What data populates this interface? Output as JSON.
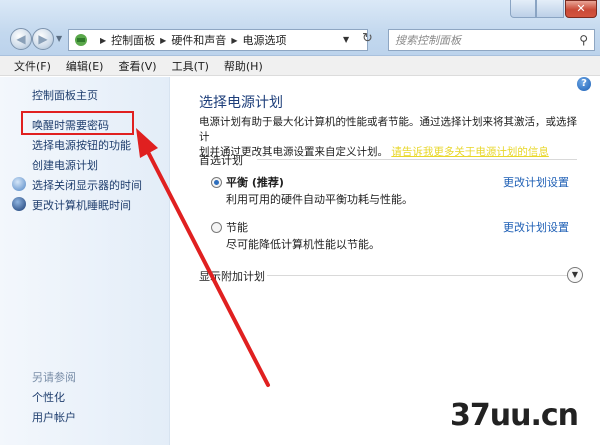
{
  "breadcrumb": [
    "控制面板",
    "硬件和声音",
    "电源选项"
  ],
  "search": {
    "placeholder": "搜索控制面板"
  },
  "menu": [
    "文件(F)",
    "编辑(E)",
    "查看(V)",
    "工具(T)",
    "帮助(H)"
  ],
  "sidebar": {
    "home": "控制面板主页",
    "items": [
      "唤醒时需要密码",
      "选择电源按钮的功能",
      "创建电源计划",
      "选择关闭显示器的时间",
      "更改计算机睡眠时间"
    ],
    "see_also_title": "另请参阅",
    "see_also": [
      "个性化",
      "用户帐户"
    ]
  },
  "main": {
    "title": "选择电源计划",
    "description_1": "电源计划有助于最大化计算机的性能或者节能。通过选择计划来将其激活，或选择计",
    "description_2": "划并通过更改其电源设置来自定义计划。",
    "description_link": "请告诉我更多关于电源计划的信息",
    "preferred_label": "首选计划",
    "plans": [
      {
        "name": "平衡 (推荐)",
        "desc": "利用可用的硬件自动平衡功耗与性能。",
        "link": "更改计划设置",
        "selected": true
      },
      {
        "name": "节能",
        "desc": "尽可能降低计算机性能以节能。",
        "link": "更改计划设置",
        "selected": false
      }
    ],
    "more_plans_label": "显示附加计划"
  },
  "watermark": "37uu.cn",
  "colors": {
    "highlight": "#e02020",
    "link": "#1e5fb5",
    "title": "#1d3e7a"
  }
}
